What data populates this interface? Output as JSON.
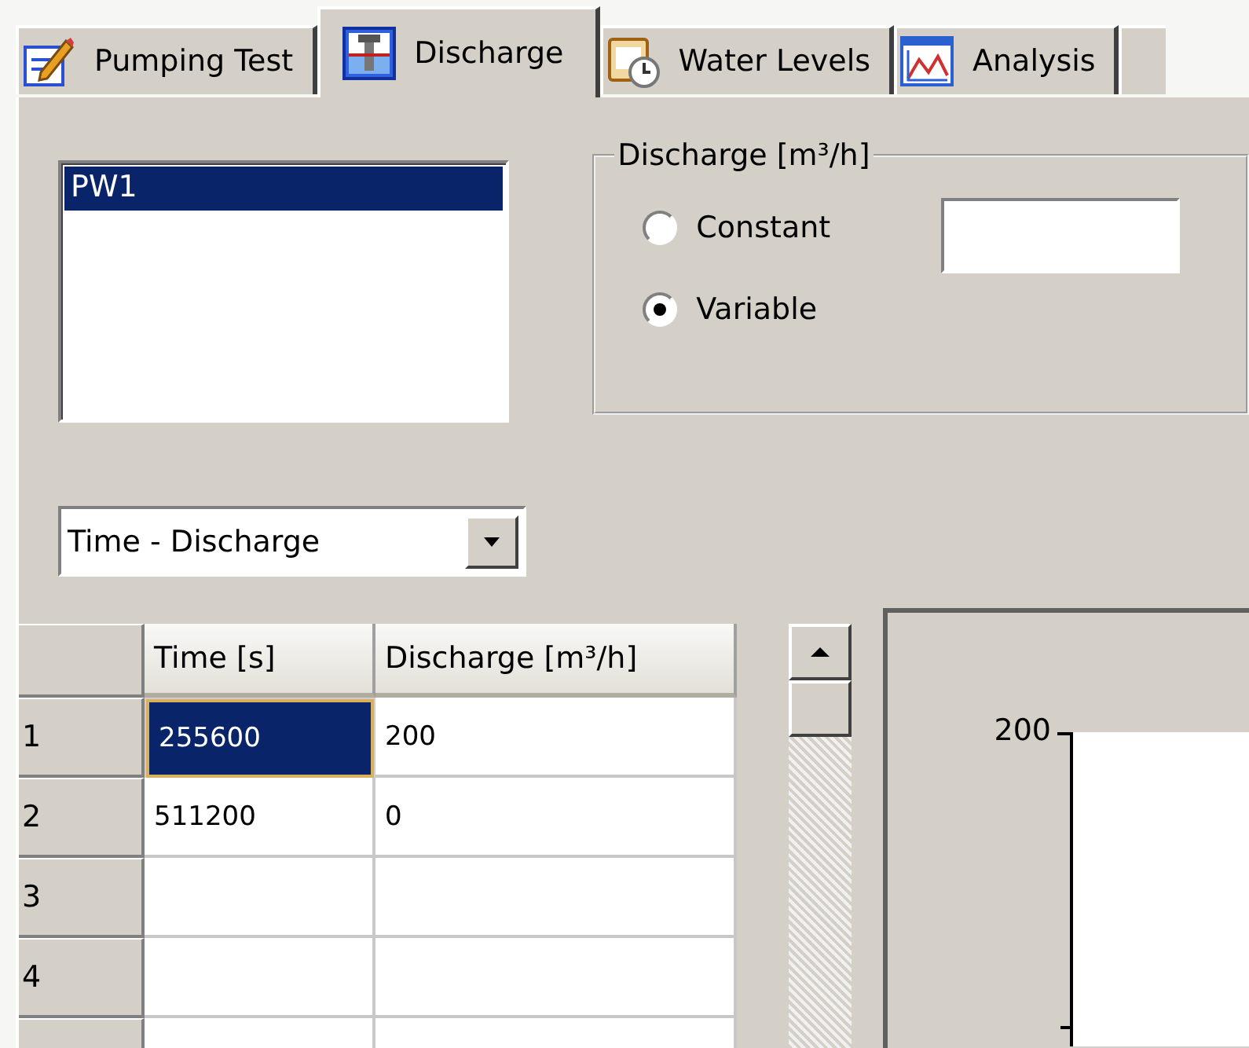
{
  "tabs": [
    {
      "label": "Pumping Test",
      "selected": false
    },
    {
      "label": "Discharge",
      "selected": true
    },
    {
      "label": "Water Levels",
      "selected": false
    },
    {
      "label": "Analysis",
      "selected": false
    }
  ],
  "well_list": {
    "items": [
      {
        "label": "PW1",
        "selected": true
      }
    ]
  },
  "discharge_group": {
    "title": "Discharge [m³/h]",
    "options": [
      {
        "label": "Constant",
        "selected": false
      },
      {
        "label": "Variable",
        "selected": true
      }
    ]
  },
  "view_select": {
    "value": "Time - Discharge"
  },
  "table": {
    "columns": [
      "Time [s]",
      "Discharge [m³/h]"
    ],
    "rows": [
      {
        "number": "1",
        "cells": [
          {
            "text": "255600",
            "selected": true
          },
          {
            "text": "200",
            "selected": false
          }
        ]
      },
      {
        "number": "2",
        "cells": [
          {
            "text": "511200",
            "selected": false
          },
          {
            "text": "0",
            "selected": false
          }
        ]
      },
      {
        "number": "3",
        "cells": [
          {
            "selected": false
          },
          {
            "selected": false
          }
        ]
      },
      {
        "number": "4",
        "cells": [
          {
            "selected": false
          },
          {
            "selected": false
          }
        ]
      }
    ]
  },
  "chart": {
    "y_tick_labels": [
      "200"
    ]
  }
}
